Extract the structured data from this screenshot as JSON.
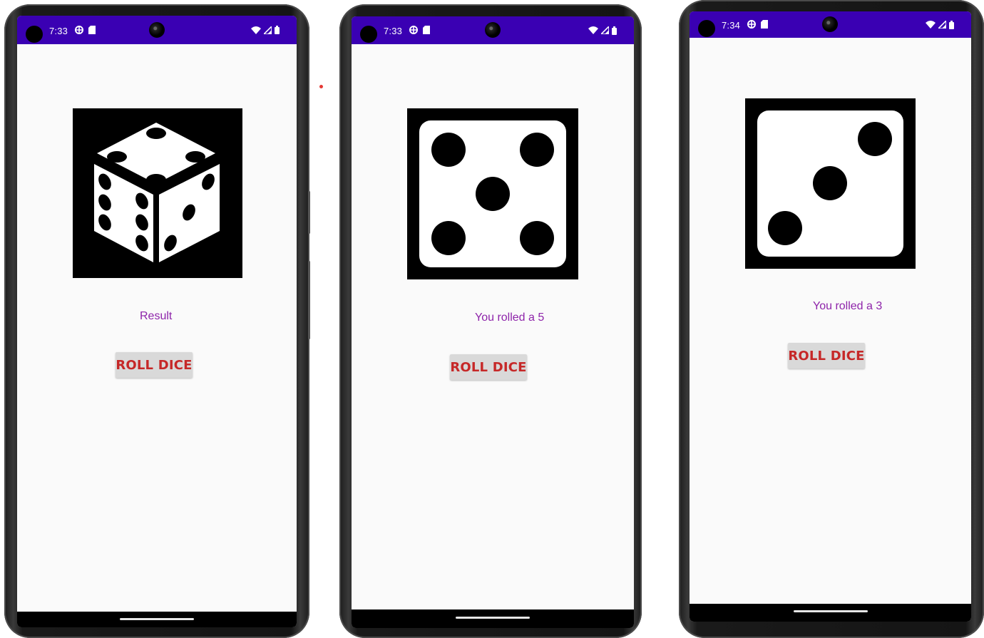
{
  "colors": {
    "status_bar": "#3a00b3",
    "screen_bg": "#fafafa",
    "result_text": "#8e24aa",
    "button_text": "#c62828",
    "button_bg": "#d9d9d9"
  },
  "screens": [
    {
      "status_time": "7:33",
      "dice_icon": "dice-3d-icon",
      "result_text": "Result",
      "button_label": "ROLL DICE"
    },
    {
      "status_time": "7:33",
      "dice_icon": "dice-face-5-icon",
      "result_text": "You rolled a 5",
      "button_label": "ROLL DICE"
    },
    {
      "status_time": "7:34",
      "dice_icon": "dice-face-3-icon",
      "result_text": "You rolled a 3",
      "button_label": "ROLL DICE"
    }
  ]
}
